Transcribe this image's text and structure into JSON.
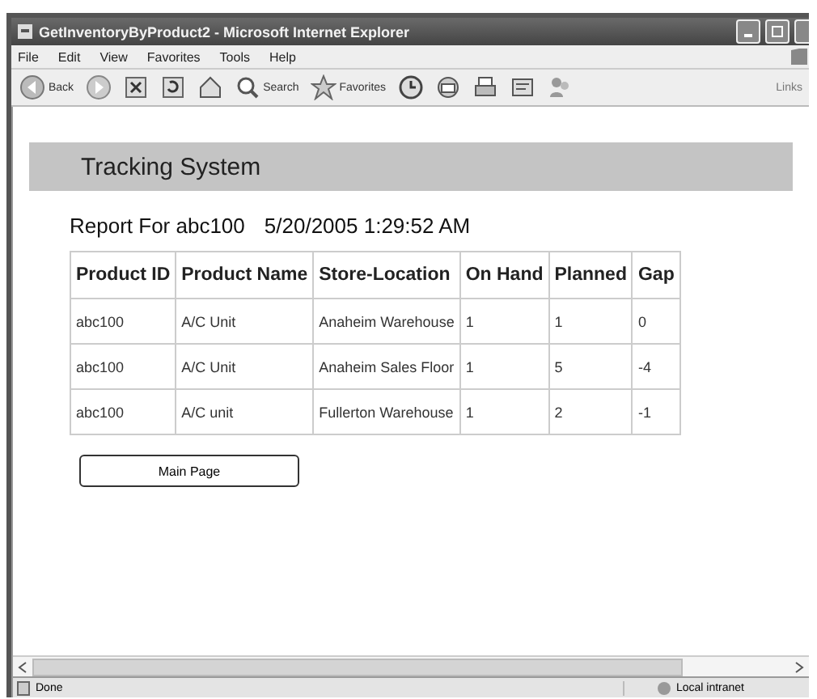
{
  "window": {
    "title": "GetInventoryByProduct2 - Microsoft Internet Explorer"
  },
  "menu": [
    "File",
    "Edit",
    "View",
    "Favorites",
    "Tools",
    "Help"
  ],
  "toolbar": [
    {
      "kind": "back",
      "label": "Back"
    },
    {
      "kind": "forward"
    },
    {
      "kind": "stop"
    },
    {
      "kind": "refresh"
    },
    {
      "kind": "home"
    },
    {
      "kind": "search",
      "label": "Search"
    },
    {
      "kind": "favorites",
      "label": "Favorites"
    },
    {
      "kind": "history"
    },
    {
      "kind": "mail"
    },
    {
      "kind": "print"
    },
    {
      "kind": "edit"
    },
    {
      "kind": "messenger"
    }
  ],
  "links": "Links",
  "page": {
    "header": "Tracking System",
    "report_title": "Report For abc100",
    "timestamp": "5/20/2005 1:29:52 AM",
    "table": {
      "columns": [
        "Product ID",
        "Product Name",
        "Store-Location",
        "On Hand",
        "Planned",
        "Gap"
      ],
      "rows": [
        [
          "abc100",
          "A/C Unit",
          "Anaheim Warehouse",
          "1",
          "1",
          "0"
        ],
        [
          "abc100",
          "A/C Unit",
          "Anaheim Sales Floor",
          "1",
          "5",
          "-4"
        ],
        [
          "abc100",
          "A/C unit",
          "Fullerton Warehouse",
          "1",
          "2",
          "-1"
        ]
      ]
    },
    "button": "Main Page"
  },
  "status_bar": {
    "text": "Done",
    "zone": "Local intranet"
  }
}
